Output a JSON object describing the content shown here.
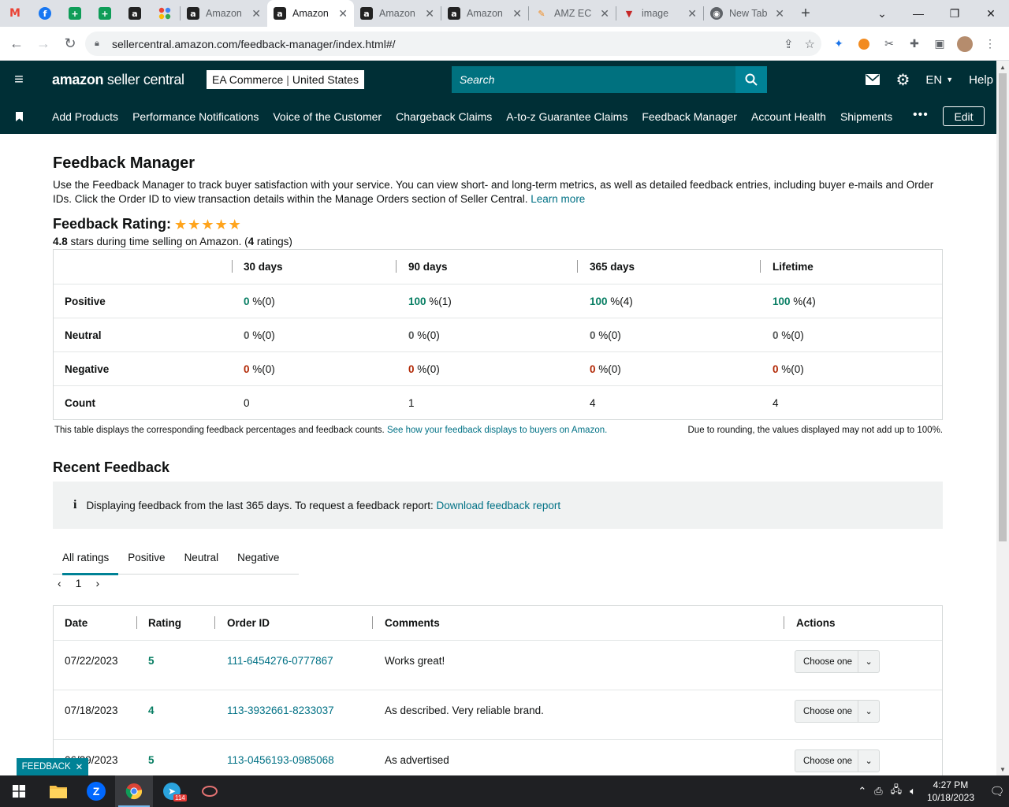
{
  "browser": {
    "tabs": [
      {
        "title": "Amazon",
        "favicon": "amazon-icon",
        "active": false
      },
      {
        "title": "Amazon",
        "favicon": "amazon-icon",
        "active": true
      },
      {
        "title": "Amazon",
        "favicon": "amazon-icon",
        "active": false
      },
      {
        "title": "Amazon",
        "favicon": "amazon-icon",
        "active": false
      },
      {
        "title": "AMZ EC",
        "favicon": "pencil-icon",
        "active": false
      },
      {
        "title": "image",
        "favicon": "triangle-icon",
        "active": false
      },
      {
        "title": "New Tab",
        "favicon": "chrome-icon",
        "active": false
      }
    ],
    "url": "sellercentral.amazon.com/feedback-manager/index.html#/"
  },
  "header": {
    "logo_brand": "amazon",
    "logo_suffix": " seller central",
    "account_name": "EA Commerce",
    "account_region": "United States",
    "search_placeholder": "Search",
    "language": "EN",
    "help": "Help"
  },
  "nav": {
    "items": [
      "Add Products",
      "Performance Notifications",
      "Voice of the Customer",
      "Chargeback Claims",
      "A-to-z Guarantee Claims",
      "Feedback Manager",
      "Account Health",
      "Shipments"
    ],
    "more": "•••",
    "edit": "Edit"
  },
  "page": {
    "title": "Feedback Manager",
    "intro": "Use the Feedback Manager to track buyer satisfaction with your service. You can view short- and long-term metrics, as well as detailed feedback entries, including buyer e-mails and Order IDs. Click the Order ID to view transaction details within the Manage Orders section of Seller Central.",
    "learn_more": "Learn more",
    "rating_label": "Feedback Rating:",
    "rating_stars": 4.8,
    "rating_value": "4.8",
    "rating_mid": " stars during time selling on Amazon. (",
    "rating_count": "4",
    "rating_end": " ratings)",
    "table_headers": [
      "30 days",
      "90 days",
      "365 days",
      "Lifetime"
    ],
    "rows": [
      {
        "label": "Positive",
        "values": [
          {
            "num": "0",
            "rest": " %(0)"
          },
          {
            "num": "100",
            "rest": " %(1)"
          },
          {
            "num": "100",
            "rest": " %(4)"
          },
          {
            "num": "100",
            "rest": " %(4)"
          }
        ]
      },
      {
        "label": "Neutral",
        "values": [
          {
            "num": "0",
            "rest": " %(0)"
          },
          {
            "num": "0",
            "rest": " %(0)"
          },
          {
            "num": "0",
            "rest": " %(0)"
          },
          {
            "num": "0",
            "rest": " %(0)"
          }
        ]
      },
      {
        "label": "Negative",
        "values": [
          {
            "num": "0",
            "rest": " %(0)"
          },
          {
            "num": "0",
            "rest": " %(0)"
          },
          {
            "num": "0",
            "rest": " %(0)"
          },
          {
            "num": "0",
            "rest": " %(0)"
          }
        ]
      },
      {
        "label": "Count",
        "values": [
          {
            "num": "0",
            "rest": ""
          },
          {
            "num": "1",
            "rest": ""
          },
          {
            "num": "4",
            "rest": ""
          },
          {
            "num": "4",
            "rest": ""
          }
        ]
      }
    ],
    "note_left": "This table displays the corresponding feedback percentages and feedback counts.",
    "note_link": "See how your feedback displays to buyers on Amazon.",
    "note_right": "Due to rounding, the values displayed may not add up to 100%.",
    "recent_title": "Recent Feedback",
    "info_text": "Displaying feedback from the last 365 days. To request a feedback report:",
    "info_link": "Download feedback report",
    "filter_tabs": [
      "All ratings",
      "Positive",
      "Neutral",
      "Negative"
    ],
    "page_number": "1",
    "order_headers": [
      "Date",
      "Rating",
      "Order ID",
      "Comments",
      "Actions"
    ],
    "orders": [
      {
        "date": "07/22/2023",
        "rating": "5",
        "order_id": "111-6454276-0777867",
        "comment": "Works great!",
        "action": "Choose one"
      },
      {
        "date": "07/18/2023",
        "rating": "4",
        "order_id": "113-3932661-8233037",
        "comment": "As described. Very reliable brand.",
        "action": "Choose one"
      },
      {
        "date": "06/29/2023",
        "rating": "5",
        "order_id": "113-0456193-0985068",
        "comment": "As advertised",
        "action": "Choose one"
      }
    ],
    "feedback_float": "FEEDBACK"
  },
  "taskbar": {
    "time": "4:27 PM",
    "date": "10/18/2023",
    "telegram_badge": "114"
  },
  "colors": {
    "header_bg": "#002f36",
    "link": "#007185",
    "positive": "#067d62",
    "negative": "#b12704",
    "star": "#ffa41c"
  }
}
